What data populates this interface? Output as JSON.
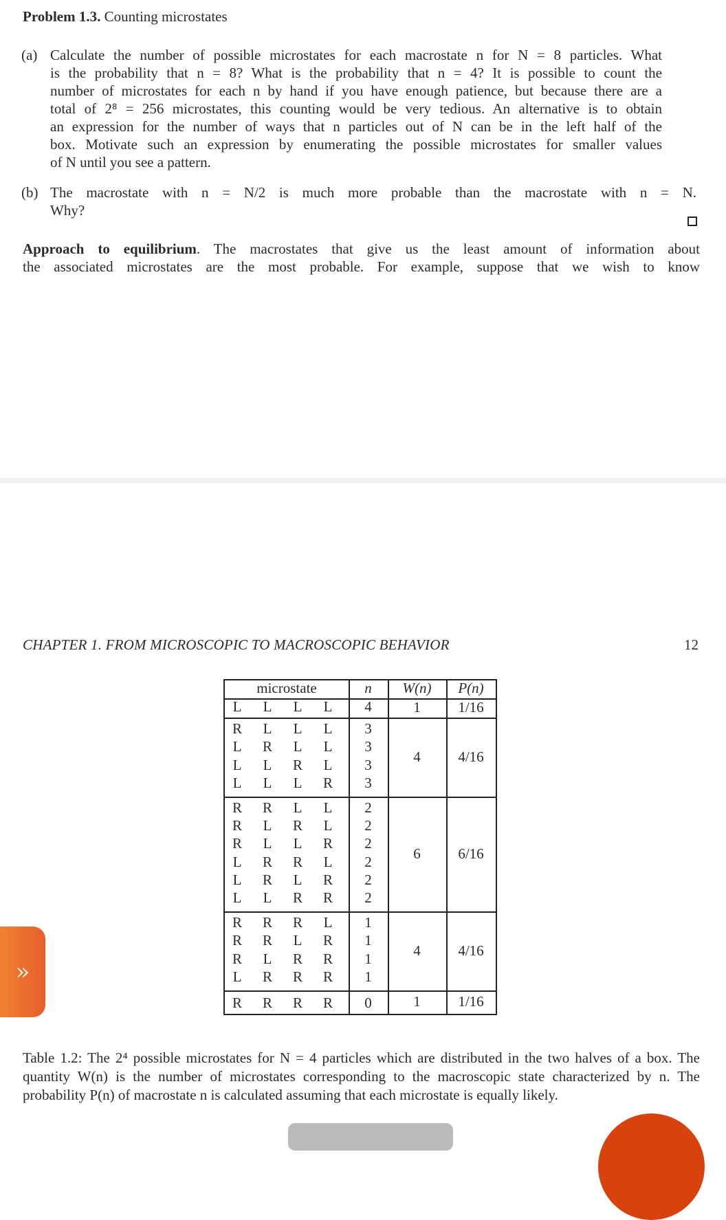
{
  "problem": {
    "label": "Problem 1.3.",
    "title": "Counting microstates",
    "part_a": {
      "marker": "(a)",
      "lines": [
        "Calculate the number of possible microstates for each macrostate n for N = 8 particles. What",
        "is the probability that n = 8? What is the probability that n = 4? It is possible to count the",
        "number of microstates for each n by hand if you have enough patience, but because there are a",
        "total of 2⁸ = 256 microstates, this counting would be very tedious. An alternative is to obtain",
        "an expression for the number of ways that n particles out of N can be in the left half of the",
        "box. Motivate such an expression by enumerating the possible microstates for smaller values",
        "of N until you see a pattern."
      ]
    },
    "part_b": {
      "marker": "(b)",
      "lines": [
        "The macrostate with n = N/2 is much more probable than the macrostate with n = N.",
        "Why?"
      ]
    },
    "qed_symbol": "□"
  },
  "approach": {
    "heading": "Approach to equilibrium",
    "lines": [
      ". The macrostates that give us the least amount of information about",
      "the associated microstates are the most probable.  For example, suppose that we wish to know"
    ]
  },
  "page2": {
    "chapter_header": "CHAPTER 1.   FROM MICROSCOPIC TO MACROSCOPIC BEHAVIOR",
    "page_number": "12"
  },
  "table": {
    "headers": [
      "microstate",
      "n",
      "W(n)",
      "P(n)"
    ],
    "groups": [
      {
        "rows": [
          [
            "L",
            "L",
            "L",
            "L"
          ]
        ],
        "n": [
          "4"
        ],
        "W": "1",
        "P": "1/16"
      },
      {
        "rows": [
          [
            "R",
            "L",
            "L",
            "L"
          ],
          [
            "L",
            "R",
            "L",
            "L"
          ],
          [
            "L",
            "L",
            "R",
            "L"
          ],
          [
            "L",
            "L",
            "L",
            "R"
          ]
        ],
        "n": [
          "3",
          "3",
          "3",
          "3"
        ],
        "W": "4",
        "P": "4/16"
      },
      {
        "rows": [
          [
            "R",
            "R",
            "L",
            "L"
          ],
          [
            "R",
            "L",
            "R",
            "L"
          ],
          [
            "R",
            "L",
            "L",
            "R"
          ],
          [
            "L",
            "R",
            "R",
            "L"
          ],
          [
            "L",
            "R",
            "L",
            "R"
          ],
          [
            "L",
            "L",
            "R",
            "R"
          ]
        ],
        "n": [
          "2",
          "2",
          "2",
          "2",
          "2",
          "2"
        ],
        "W": "6",
        "P": "6/16"
      },
      {
        "rows": [
          [
            "R",
            "R",
            "R",
            "L"
          ],
          [
            "R",
            "R",
            "L",
            "R"
          ],
          [
            "R",
            "L",
            "R",
            "R"
          ],
          [
            "L",
            "R",
            "R",
            "R"
          ]
        ],
        "n": [
          "1",
          "1",
          "1",
          "1"
        ],
        "W": "4",
        "P": "4/16"
      },
      {
        "rows": [
          [
            "R",
            "R",
            "R",
            "R"
          ]
        ],
        "n": [
          "0"
        ],
        "W": "1",
        "P": "1/16"
      }
    ]
  },
  "caption": {
    "text": "Table 1.2: The 2⁴ possible microstates for N = 4 particles which are distributed in the two halves of a box.  The quantity W(n) is the number of microstates corresponding to the macroscopic state characterized by n. The probability P(n) of macrostate n is calculated assuming that each microstate is equally likely."
  },
  "ui": {
    "side_tab_icon": "»",
    "colors": {
      "side_tab_start": "#ee8233",
      "side_tab_end": "#e65f2c",
      "fab": "#d8420c",
      "pill": "#bbbbbb",
      "separator": "#f1f1f1"
    }
  }
}
